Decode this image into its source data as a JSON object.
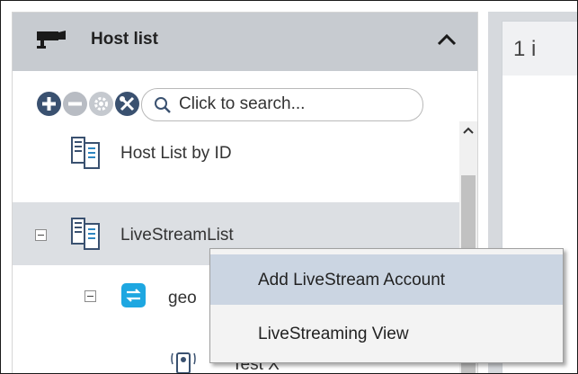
{
  "host_panel": {
    "title": "Host list",
    "search": {
      "placeholder": "Click to search..."
    },
    "toolbar_icons": [
      "add-icon",
      "remove-icon",
      "gear-icon",
      "tools-icon"
    ]
  },
  "tree": {
    "items": [
      {
        "label": "Host List by ID",
        "icon": "host-list-icon"
      },
      {
        "label": "LiveStreamList",
        "icon": "host-list-icon",
        "expanded": true
      },
      {
        "label": "geo",
        "icon": "stream-icon",
        "expanded": true
      },
      {
        "label": "Test X",
        "icon": "camera-icon"
      }
    ]
  },
  "right_panel": {
    "title": "1 i"
  },
  "context_menu": {
    "items": [
      {
        "label": "Add LiveStream Account",
        "highlighted": true
      },
      {
        "label": "LiveStreaming View"
      }
    ]
  },
  "colors": {
    "header_bg": "#c7cbd0",
    "accent_icon": "#3a5170",
    "stream_icon": "#1ea7e1",
    "menu_highlight": "#cbd5e2"
  }
}
